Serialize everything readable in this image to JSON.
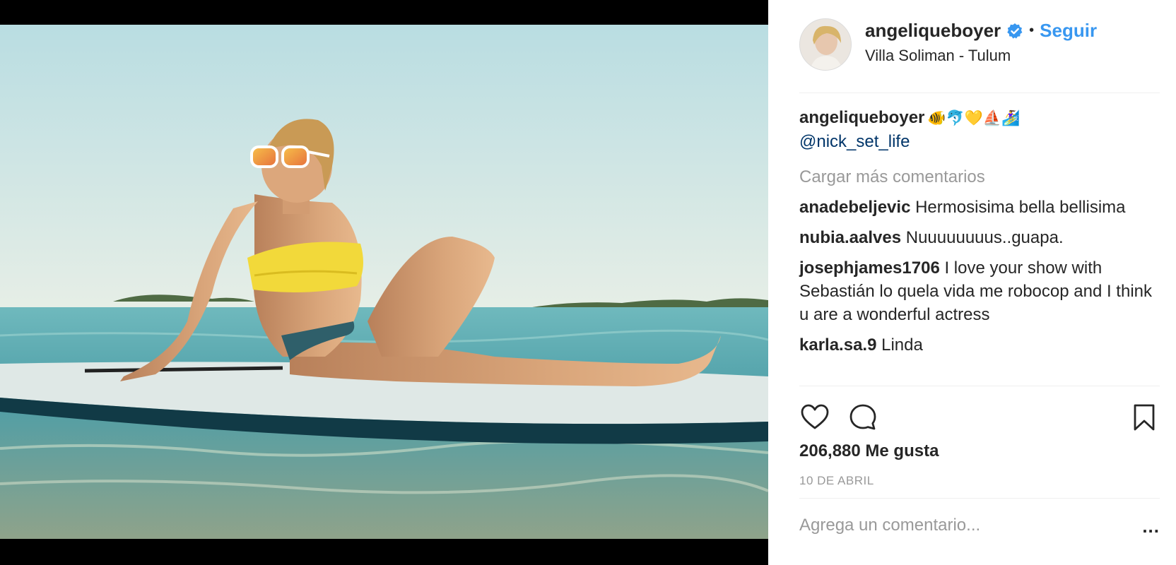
{
  "post": {
    "username": "angeliqueboyer",
    "separator": "•",
    "follow_label": "Seguir",
    "location": "Villa Soliman - Tulum",
    "verified_icon": "verified-badge-icon"
  },
  "caption": {
    "username": "angeliqueboyer",
    "emojis": "🐠🐬💛⛵🏄‍♀️",
    "mention": "@nick_set_life"
  },
  "load_more_label": "Cargar más comentarios",
  "comments": [
    {
      "user": "anadebeljevic",
      "text": "Hermosisima bella bellisima"
    },
    {
      "user": "nubia.aalves",
      "text": "Nuuuuuuuus..guapa."
    },
    {
      "user": "josephjames1706",
      "text": "I love your show with Sebastián lo quela vida me robocop and I think u are a wonderful actress"
    },
    {
      "user": "karla.sa.9",
      "text": "Linda"
    }
  ],
  "actions": {
    "like_icon": "heart-icon",
    "comment_icon": "comment-bubble-icon",
    "save_icon": "bookmark-icon"
  },
  "likes_label": "206,880 Me gusta",
  "date_label": "10 DE ABRIL",
  "add_comment_placeholder": "Agrega un comentario...",
  "more_label": "...",
  "colors": {
    "link_blue": "#3897f0",
    "mention_blue": "#003569",
    "muted_gray": "#999999",
    "text": "#262626"
  }
}
